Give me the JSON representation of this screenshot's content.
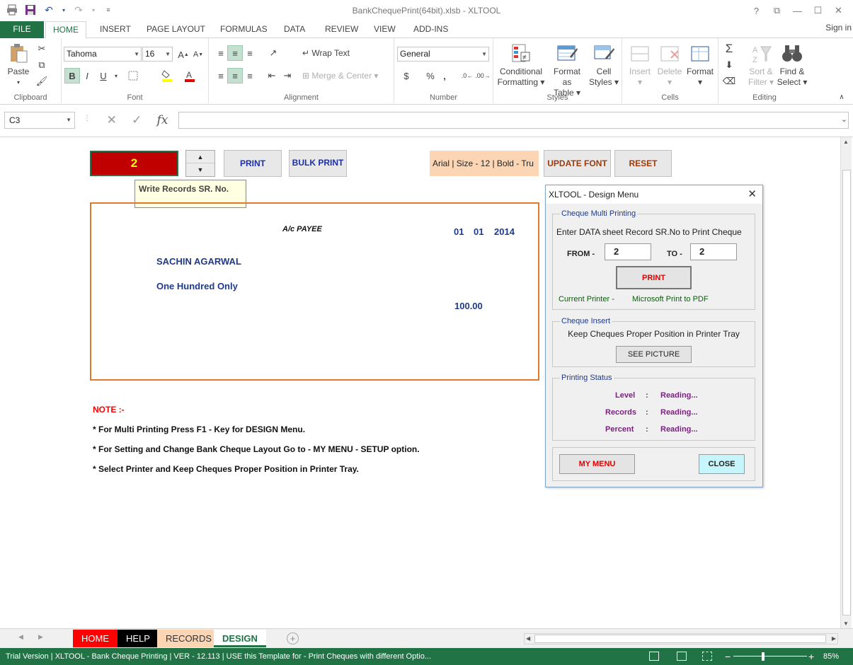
{
  "window": {
    "title": "BankChequePrint(64bit).xlsb - XLTOOL",
    "signin": "Sign in"
  },
  "tabs": [
    "FILE",
    "HOME",
    "INSERT",
    "PAGE LAYOUT",
    "FORMULAS",
    "DATA",
    "REVIEW",
    "VIEW",
    "ADD-INS"
  ],
  "ribbon": {
    "clipboard": {
      "paste": "Paste",
      "label": "Clipboard"
    },
    "font": {
      "name": "Tahoma",
      "size": "16",
      "bold": "B",
      "italic": "I",
      "underline": "U",
      "label": "Font"
    },
    "alignment": {
      "wrap": "Wrap Text",
      "merge": "Merge & Center",
      "label": "Alignment"
    },
    "number": {
      "format": "General",
      "currency": "$",
      "percent": "%",
      "comma": ",",
      "label": "Number"
    },
    "styles": {
      "conditional": "Conditional",
      "conditional2": "Formatting",
      "formatas": "Format as",
      "formatas2": "Table",
      "cell": "Cell",
      "cell2": "Styles",
      "label": "Styles"
    },
    "cells": {
      "insert": "Insert",
      "delete": "Delete",
      "format": "Format",
      "label": "Cells"
    },
    "editing": {
      "sort": "Sort &",
      "sort2": "Filter",
      "find": "Find &",
      "find2": "Select",
      "label": "Editing"
    }
  },
  "formula_bar": {
    "name_box": "C3",
    "fx": "fx",
    "value": ""
  },
  "sheet": {
    "sr_value": "2",
    "print_button": "PRINT",
    "bulk_print_button": "BULK PRINT",
    "font_info": "Arial | Size - 12 | Bold - Tru",
    "update_font_button": "UPDATE FONT",
    "reset_button": "RESET",
    "tooltip": "Write Records SR. No.",
    "cheque": {
      "payee_tag": "A/c  PAYEE",
      "date_day": "01",
      "date_month": "01",
      "date_year": "2014",
      "payee_name": "SACHIN AGARWAL",
      "amount_words": "One Hundred  Only",
      "amount": "100.00"
    },
    "notes": {
      "heading": "NOTE :-",
      "line1": "* For Multi Printing Press F1 - Key for DESIGN Menu.",
      "line2": "* For Setting and Change Bank Cheque Layout Go to - MY MENU - SETUP option.",
      "line3": "* Select Printer and Keep Cheques Proper Position in Printer Tray."
    }
  },
  "dialog": {
    "title": "XLTOOL - Design Menu",
    "multi": {
      "label": "Cheque Multi Printing",
      "instruction": "Enter DATA sheet Record SR.No to Print Cheque",
      "from_label": "FROM -",
      "from_value": "2",
      "to_label": "TO -",
      "to_value": "2",
      "print_button": "PRINT",
      "current_printer_label": "Current Printer -",
      "current_printer": "Microsoft Print to PDF"
    },
    "insert": {
      "label": "Cheque Insert",
      "text": "Keep Cheques Proper Position in Printer Tray",
      "see_picture": "SEE PICTURE"
    },
    "status": {
      "label": "Printing Status",
      "level_label": "Level",
      "records_label": "Records",
      "percent_label": "Percent",
      "colon": ":",
      "level_value": "Reading...",
      "records_value": "Reading...",
      "percent_value": "Reading..."
    },
    "my_menu_button": "MY MENU",
    "close_button": "CLOSE"
  },
  "sheet_tabs": [
    {
      "label": "HOME",
      "bg": "#ff0000",
      "color": "#ffffff"
    },
    {
      "label": "HELP",
      "bg": "#000000",
      "color": "#ffffff"
    },
    {
      "label": "RECORDS",
      "bg": "#fcd5b4",
      "color": "#333333"
    },
    {
      "label": "DESIGN",
      "bg": "#ffffff",
      "color": "#217346"
    }
  ],
  "status_bar": {
    "text": "Trial Version  |  XLTOOL - Bank Cheque Printing  |  VER - 12.113  |  USE this Template for - Print Cheques with different Optio...",
    "zoom": "85%"
  },
  "colors": {
    "excel_green": "#217346",
    "cheque_text": "#1f3a8a",
    "cheque_border": "#e0782e",
    "sr_box": "#c00000"
  }
}
